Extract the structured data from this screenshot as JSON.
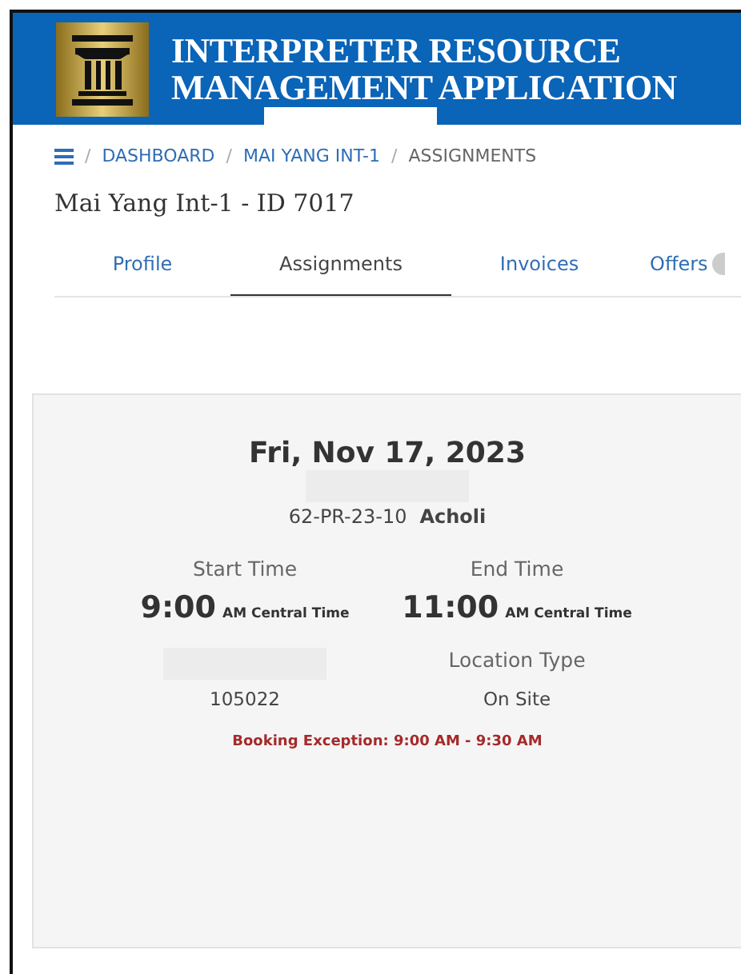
{
  "header": {
    "title_lines": [
      "INTERPRETER RESOURCE",
      "MANAGEMENT APPLICATION"
    ]
  },
  "breadcrumb": {
    "separator": "/",
    "items": [
      {
        "label": "DASHBOARD",
        "link": true
      },
      {
        "label": "MAI YANG INT-1",
        "link": true
      },
      {
        "label": "ASSIGNMENTS",
        "link": false
      }
    ]
  },
  "page_title": "Mai Yang Int-1 - ID 7017",
  "tabs": [
    {
      "label": "Profile",
      "selected": false
    },
    {
      "label": "Assignments",
      "selected": true
    },
    {
      "label": "Invoices",
      "selected": false
    },
    {
      "label": "Offers",
      "selected": false
    }
  ],
  "assignment": {
    "date": "Fri, Nov 17, 2023",
    "code": "62-PR-23-10",
    "language": "Acholi",
    "start": {
      "label": "Start Time",
      "time": "9:00",
      "zone": "AM Central Time"
    },
    "end": {
      "label": "End Time",
      "time": "11:00",
      "zone": "AM Central Time"
    },
    "number": "105022",
    "location_label": "Location Type",
    "location": "On Site",
    "exception": "Booking Exception: 9:00 AM - 9:30 AM"
  }
}
